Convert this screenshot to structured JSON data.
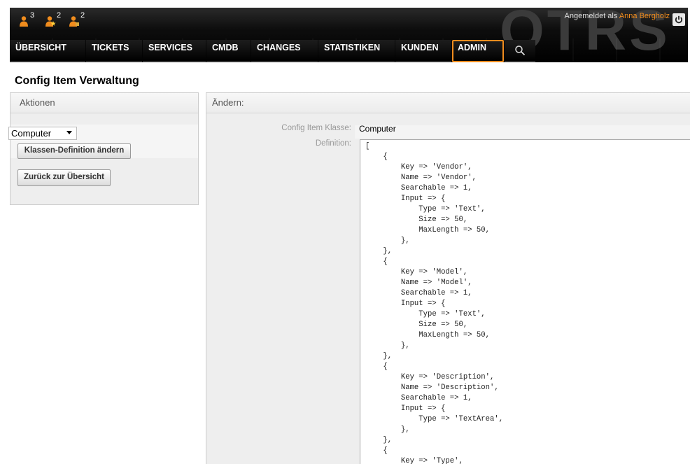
{
  "header": {
    "logo_text": "OTRS",
    "login_prefix": "Angemeldet als",
    "user_name": "Anna Bergholz",
    "toolbar": [
      {
        "icon": "person-icon",
        "count": "3"
      },
      {
        "icon": "person-star-icon",
        "count": "2"
      },
      {
        "icon": "person-lock-icon",
        "count": "2"
      }
    ]
  },
  "nav": {
    "items": [
      "ÜBERSICHT",
      "TICKETS",
      "SERVICES",
      "CMDB",
      "CHANGES",
      "STATISTIKEN",
      "KUNDEN",
      "ADMIN"
    ],
    "selected": "ADMIN"
  },
  "page": {
    "title": "Config Item Verwaltung"
  },
  "sidebar": {
    "heading": "Aktionen",
    "class_select_value": "Computer",
    "edit_button": "Klassen-Definition ändern",
    "back_button": "Zurück zur Übersicht"
  },
  "main": {
    "heading": "Ändern:",
    "class_label": "Config Item Klasse:",
    "class_value": "Computer",
    "definition_label": "Definition:",
    "definition": "[\n    {\n        Key => 'Vendor',\n        Name => 'Vendor',\n        Searchable => 1,\n        Input => {\n            Type => 'Text',\n            Size => 50,\n            MaxLength => 50,\n        },\n    },\n    {\n        Key => 'Model',\n        Name => 'Model',\n        Searchable => 1,\n        Input => {\n            Type => 'Text',\n            Size => 50,\n            MaxLength => 50,\n        },\n    },\n    {\n        Key => 'Description',\n        Name => 'Description',\n        Searchable => 1,\n        Input => {\n            Type => 'TextArea',\n        },\n    },\n    {\n        Key => 'Type',"
  },
  "colors": {
    "accent": "#f08c1d",
    "header_bg": "#000000"
  }
}
